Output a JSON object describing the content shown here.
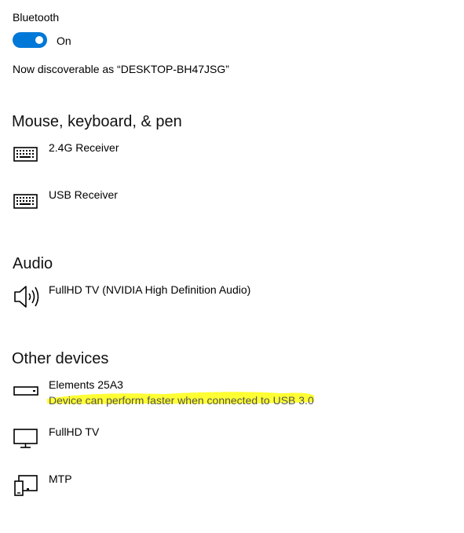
{
  "bluetooth": {
    "label": "Bluetooth",
    "toggle_state": "On",
    "discoverable_text": "Now discoverable as “DESKTOP-BH47JSG”",
    "accent_color": "#0078d7"
  },
  "sections": {
    "mouse": {
      "title": "Mouse, keyboard, & pen",
      "devices": [
        {
          "name": "2.4G Receiver",
          "icon": "keyboard-icon"
        },
        {
          "name": "USB Receiver",
          "icon": "keyboard-icon"
        }
      ]
    },
    "audio": {
      "title": "Audio",
      "devices": [
        {
          "name": "FullHD TV (NVIDIA High Definition Audio)",
          "icon": "speaker-icon"
        }
      ]
    },
    "other": {
      "title": "Other devices",
      "devices": [
        {
          "name": "Elements 25A3",
          "status": "Device can perform faster when connected to USB 3.0",
          "icon": "drive-icon"
        },
        {
          "name": "FullHD TV",
          "icon": "monitor-icon"
        },
        {
          "name": "MTP",
          "icon": "phone-device-icon"
        }
      ]
    }
  },
  "annotation": {
    "highlight_color": "#ffff33"
  }
}
